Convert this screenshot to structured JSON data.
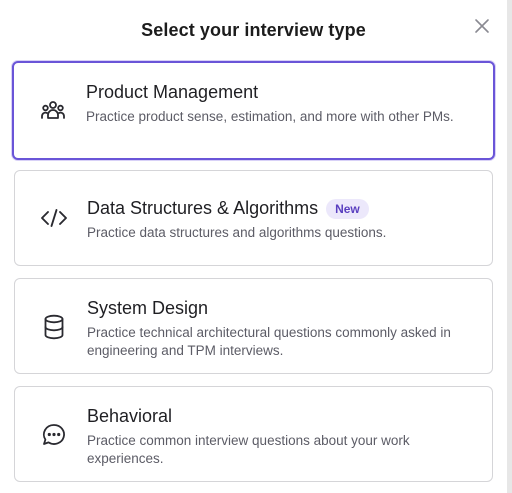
{
  "modal": {
    "title": "Select your interview type",
    "close_icon": "close-icon"
  },
  "options": [
    {
      "heading": "Product Management",
      "description": "Practice product sense, estimation, and more with other PMs.",
      "icon": "people-group-icon",
      "selected": true
    },
    {
      "heading": "Data Structures & Algorithms",
      "badge": "New",
      "description": "Practice data structures and algorithms questions.",
      "icon": "code-brackets-icon",
      "selected": false
    },
    {
      "heading": "System Design",
      "description": "Practice technical architectural questions commonly asked in engineering and TPM interviews.",
      "icon": "database-icon",
      "selected": false
    },
    {
      "heading": "Behavioral",
      "description": "Practice common interview questions about your work experiences.",
      "icon": "chat-bubble-icon",
      "selected": false
    }
  ],
  "colors": {
    "selected_border": "#6a55d8",
    "badge_bg": "#ece8fb",
    "badge_text": "#5a3fc0"
  }
}
